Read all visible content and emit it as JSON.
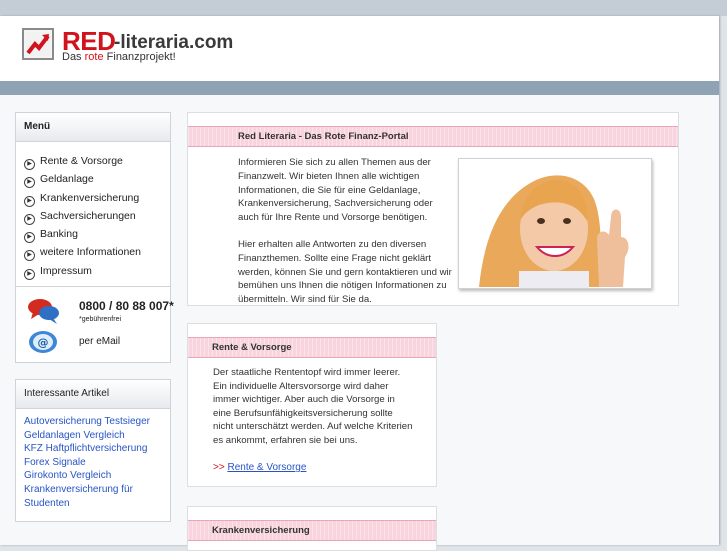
{
  "header": {
    "brand_red": "RED",
    "brand_rest": "-literaria.com",
    "tagline_pre": "Das ",
    "tagline_red": "rote",
    "tagline_post": " Finanzprojekt!",
    "brand_color": "#d1141b"
  },
  "sidebar": {
    "menu_title": "Menü",
    "menu_items": [
      {
        "label": "Rente & Vorsorge"
      },
      {
        "label": "Geldanlage"
      },
      {
        "label": "Krankenversicherung"
      },
      {
        "label": "Sachversicherungen"
      },
      {
        "label": "Banking"
      },
      {
        "label": "weitere Informationen"
      },
      {
        "label": "Impressum"
      }
    ],
    "contact": {
      "phone": "0800 / 80 88 007*",
      "phone_note": "*gebührenfrei",
      "email_label": "per eMail"
    },
    "articles_title": "Interessante Artikel",
    "articles": [
      "Autoversicherung Testsieger",
      "Geldanlagen Vergleich",
      "KFZ Haftpflichtversicherung",
      "Forex Signale",
      "Girokonto Vergleich",
      "Krankenversicherung für Studenten"
    ]
  },
  "main": {
    "portal": {
      "title": "Red Literaria - Das Rote Finanz-Portal",
      "para1": "Informieren Sie sich zu allen Themen aus der Finanzwelt. Wir bieten Ihnen alle wichtigen Informationen, die Sie für eine Geldanlage, Krankenversicherung, Sachversicherung oder auch für Ihre Rente und Vorsorge benötigen.",
      "para2": "Hier erhalten alle Antworten zu den diversen Finanzthemen. Sollte eine Frage nicht geklärt werden, können Sie und gern kontaktieren und wir bemühen uns Ihnen die nötigen Informationen zu übermitteln. Wir sind für Sie da."
    },
    "rente": {
      "title": "Rente & Vorsorge",
      "text": "Der staatliche Rententopf wird immer leerer. Ein individuelle Altersvorsorge wird daher immer wichtiger. Aber auch die Vorsorge in eine Berufsunfähigkeitsversicherung sollte nicht unterschätzt werden. Auf welche Kriterien es ankommt, erfahren sie bei uns.",
      "link_prefix": ">> ",
      "link_label": "Rente & Vorsorge"
    },
    "kranken": {
      "title": "Krankenversicherung"
    }
  }
}
